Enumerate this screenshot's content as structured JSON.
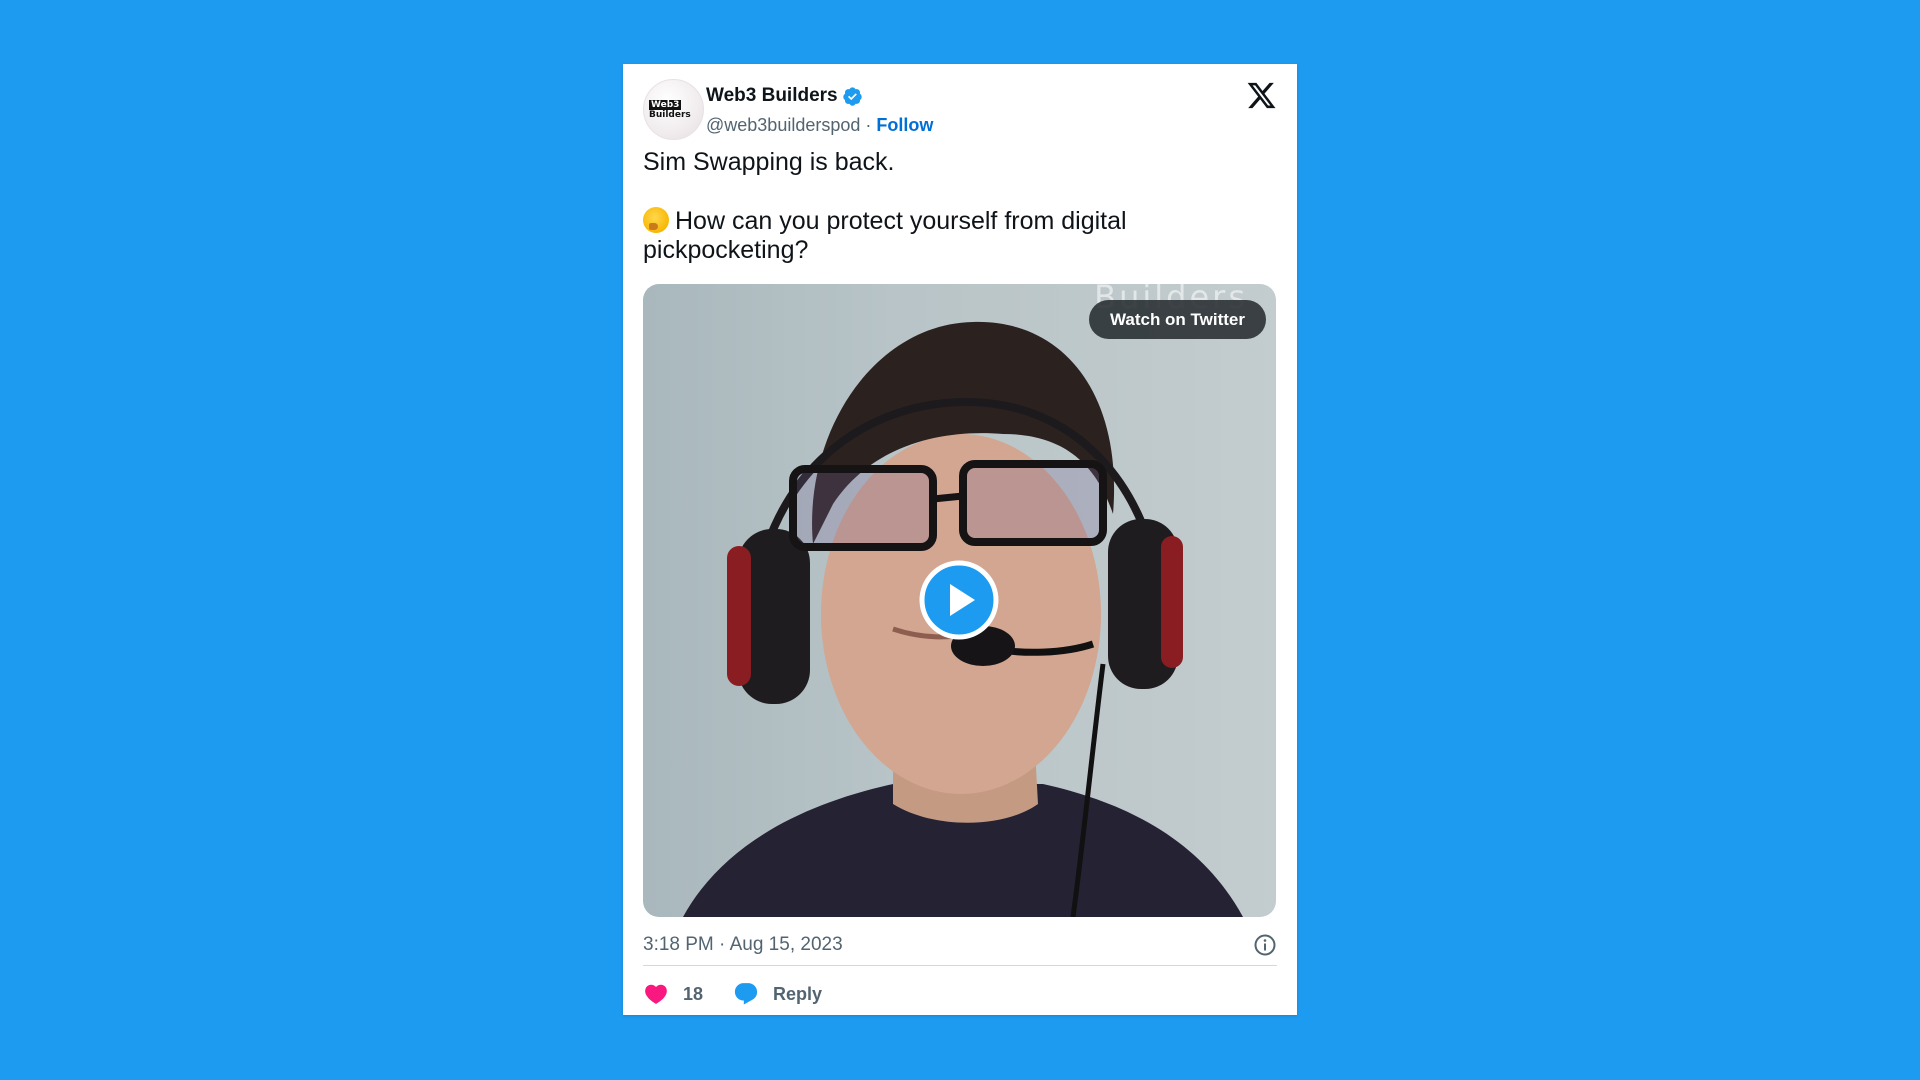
{
  "colors": {
    "background": "#1d9bf0",
    "accent": "#1d9bf0",
    "follow": "#006fd6",
    "like": "#f91880"
  },
  "author": {
    "avatar_text_line1": "Web3",
    "avatar_text_line2": "Builders",
    "display_name": "Web3 Builders",
    "verified": true,
    "handle": "@web3builderspod",
    "separator": "·",
    "follow_label": "Follow"
  },
  "tweet": {
    "line1": "Sim Swapping is back.",
    "emoji": "thinking-face-emoji",
    "line2": "How can you protect yourself from digital pickpocketing?"
  },
  "media": {
    "watch_label": "Watch on Twitter",
    "watermark": "Builders"
  },
  "footer": {
    "timestamp": "3:18 PM · Aug 15, 2023",
    "like_count": "18",
    "reply_label": "Reply"
  }
}
